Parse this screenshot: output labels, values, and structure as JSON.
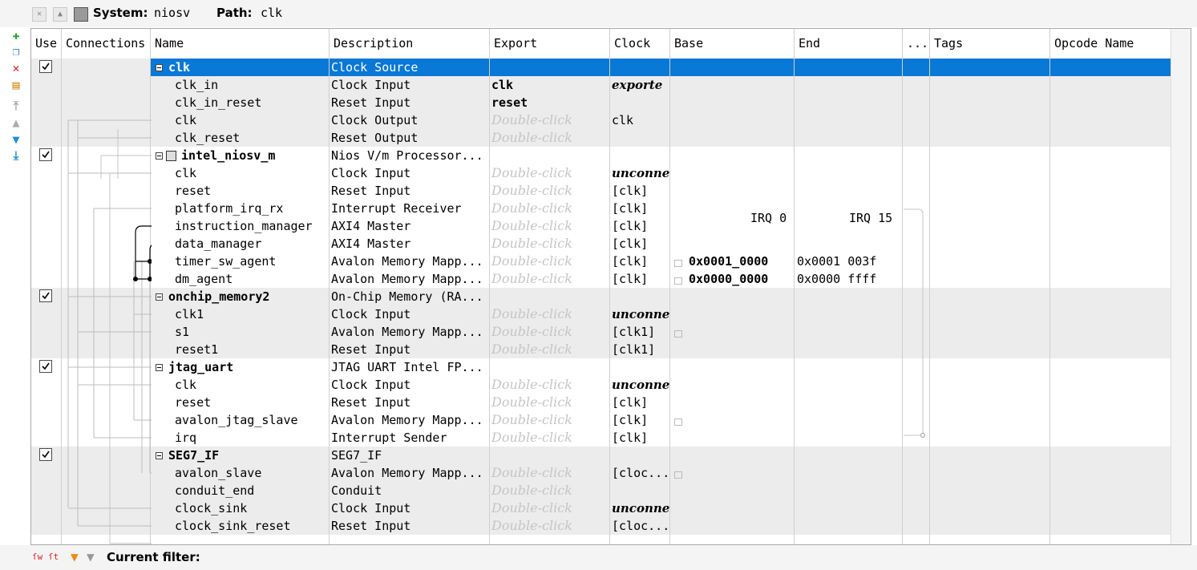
{
  "toolbar": {
    "system_label": "System:",
    "system_value": "niosv",
    "path_label": "Path:",
    "path_value": "clk"
  },
  "columns": [
    "Use",
    "Connections",
    "Name",
    "Description",
    "Export",
    "Clock",
    "Base",
    "End",
    "...",
    "Tags",
    "Opcode Name"
  ],
  "rows": [
    {
      "kind": "module",
      "check": true,
      "name": "clk",
      "desc": "Clock Source",
      "export": "",
      "clock": "",
      "base": "",
      "end": "",
      "selected": true
    },
    {
      "kind": "port",
      "name": "clk_in",
      "desc": "Clock Input",
      "export": "clk",
      "export_style": "bold",
      "clock": "exporte",
      "clock_style": "bi"
    },
    {
      "kind": "port",
      "name": "clk_in_reset",
      "desc": "Reset Input",
      "export": "reset",
      "export_style": "bold",
      "clock": ""
    },
    {
      "kind": "port",
      "name": "clk",
      "desc": "Clock Output",
      "export": "Double-click",
      "export_style": "dbl",
      "clock": "clk"
    },
    {
      "kind": "port",
      "name": "clk_reset",
      "desc": "Reset Output",
      "export": "Double-click",
      "export_style": "dbl",
      "clock": ""
    },
    {
      "kind": "module",
      "check": true,
      "name": "intel_niosv_m",
      "desc": "Nios V/m Processor...",
      "export": "",
      "clock": "",
      "icon": true
    },
    {
      "kind": "port",
      "name": "clk",
      "desc": "Clock Input",
      "export": "Double-click",
      "export_style": "dbl",
      "clock": "unconne",
      "clock_style": "bi"
    },
    {
      "kind": "port",
      "name": "reset",
      "desc": "Reset Input",
      "export": "Double-click",
      "export_style": "dbl",
      "clock": "[clk]"
    },
    {
      "kind": "port",
      "name": "platform_irq_rx",
      "desc": "Interrupt Receiver",
      "export": "Double-click",
      "export_style": "dbl",
      "clock": "[clk]"
    },
    {
      "kind": "port",
      "name": "instruction_manager",
      "desc": "AXI4 Master",
      "export": "Double-click",
      "export_style": "dbl",
      "clock": "[clk]"
    },
    {
      "kind": "port",
      "name": "data_manager",
      "desc": "AXI4 Master",
      "export": "Double-click",
      "export_style": "dbl",
      "clock": "[clk]"
    },
    {
      "kind": "port",
      "name": "timer_sw_agent",
      "desc": "Avalon Memory Mapp...",
      "export": "Double-click",
      "export_style": "dbl",
      "clock": "[clk]",
      "base": "0x0001_0000",
      "end": "0x0001 003f",
      "lock": true
    },
    {
      "kind": "port",
      "name": "dm_agent",
      "desc": "Avalon Memory Mapp...",
      "export": "Double-click",
      "export_style": "dbl",
      "clock": "[clk]",
      "base": "0x0000_0000",
      "end": "0x0000 ffff",
      "lock": true
    },
    {
      "kind": "module",
      "check": true,
      "name": "onchip_memory2",
      "desc": "On-Chip Memory (RA...",
      "export": "",
      "clock": ""
    },
    {
      "kind": "port",
      "name": "clk1",
      "desc": "Clock Input",
      "export": "Double-click",
      "export_style": "dbl",
      "clock": "unconne",
      "clock_style": "bi"
    },
    {
      "kind": "port",
      "name": "s1",
      "desc": "Avalon Memory Mapp...",
      "export": "Double-click",
      "export_style": "dbl",
      "clock": "[clk1]",
      "lock": true
    },
    {
      "kind": "port",
      "name": "reset1",
      "desc": "Reset Input",
      "export": "Double-click",
      "export_style": "dbl",
      "clock": "[clk1]"
    },
    {
      "kind": "module",
      "check": true,
      "name": "jtag_uart",
      "desc": "JTAG UART Intel FP...",
      "export": "",
      "clock": ""
    },
    {
      "kind": "port",
      "name": "clk",
      "desc": "Clock Input",
      "export": "Double-click",
      "export_style": "dbl",
      "clock": "unconne",
      "clock_style": "bi"
    },
    {
      "kind": "port",
      "name": "reset",
      "desc": "Reset Input",
      "export": "Double-click",
      "export_style": "dbl",
      "clock": "[clk]"
    },
    {
      "kind": "port",
      "name": "avalon_jtag_slave",
      "desc": "Avalon Memory Mapp...",
      "export": "Double-click",
      "export_style": "dbl",
      "clock": "[clk]",
      "lock": true
    },
    {
      "kind": "port",
      "name": "irq",
      "desc": "Interrupt Sender",
      "export": "Double-click",
      "export_style": "dbl",
      "clock": "[clk]"
    },
    {
      "kind": "module",
      "check": true,
      "name": "SEG7_IF",
      "desc": "SEG7_IF",
      "export": "",
      "clock": ""
    },
    {
      "kind": "port",
      "name": "avalon_slave",
      "desc": "Avalon Memory Mapp...",
      "export": "Double-click",
      "export_style": "dbl",
      "clock": "[cloc...",
      "lock": true
    },
    {
      "kind": "port",
      "name": "conduit_end",
      "desc": "Conduit",
      "export": "Double-click",
      "export_style": "dbl",
      "clock": ""
    },
    {
      "kind": "port",
      "name": "clock_sink",
      "desc": "Clock Input",
      "export": "Double-click",
      "export_style": "dbl",
      "clock": "unconne",
      "clock_style": "bi"
    },
    {
      "kind": "port",
      "name": "clock_sink_reset",
      "desc": "Reset Input",
      "export": "Double-click",
      "export_style": "dbl",
      "clock": "[cloc..."
    }
  ],
  "irq": {
    "start": "IRQ 0",
    "end": "IRQ 15"
  },
  "filter": {
    "label": "Current filter:"
  },
  "colors": {
    "selected": "#0a78d7",
    "shade": "#ececec"
  }
}
